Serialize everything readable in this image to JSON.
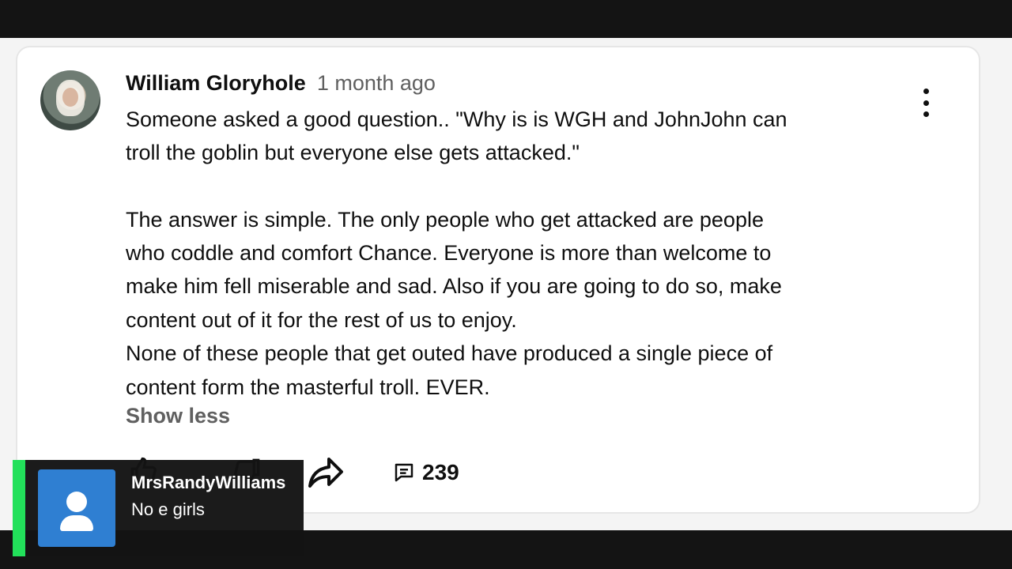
{
  "comment": {
    "author": "William Gloryhole",
    "timestamp": "1 month ago",
    "lines": [
      "Someone asked a good question.. \"Why is is WGH and JohnJohn can",
      "troll the goblin but everyone else gets attacked.\"",
      "",
      "The answer is simple. The only people who get attacked are people",
      "who coddle and comfort Chance. Everyone is more than welcome to",
      "make him fell miserable and sad. Also if you are going to do so, make",
      "content out of it for the rest of us to enjoy.",
      "None of these people that get outed have produced a single piece of",
      "content form the masterful troll. EVER."
    ],
    "show_less_label": "Show less",
    "reply_count": "239",
    "icons": {
      "menu": "more-vert-icon",
      "like": "thumb-up-icon",
      "dislike": "thumb-down-icon",
      "share": "share-icon",
      "replies": "comment-icon"
    }
  },
  "chat_overlay": {
    "username": "MrsRandyWilliams",
    "message": "No e girls",
    "accent_color": "#22e05a",
    "avatar_color": "#2f7fd2",
    "avatar_icon": "person-icon"
  }
}
